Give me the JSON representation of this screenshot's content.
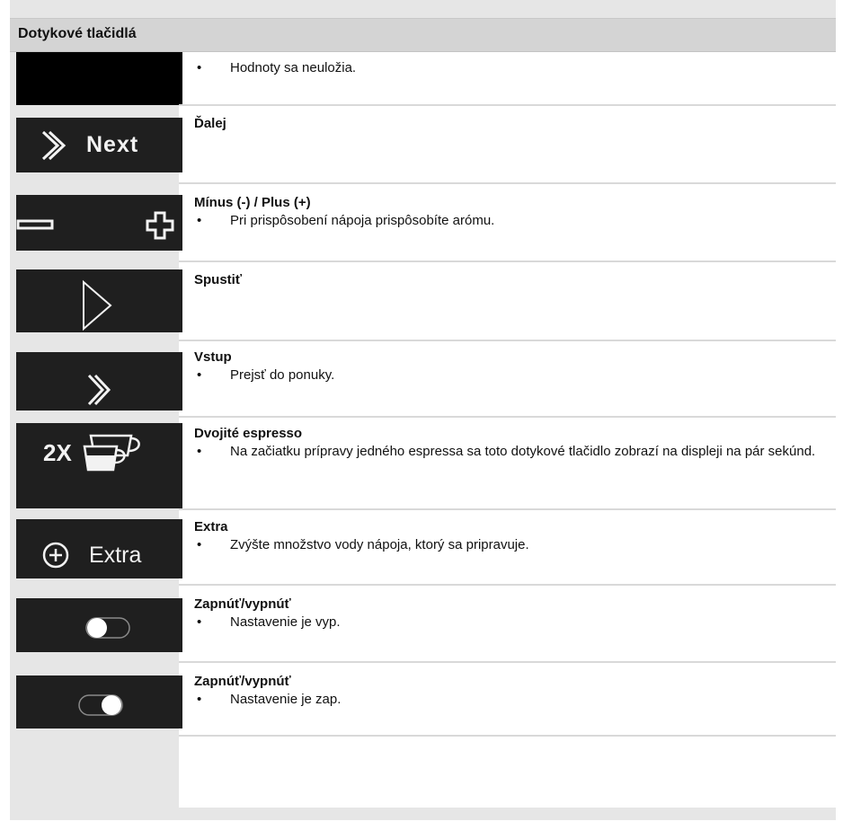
{
  "table": {
    "header": "Dotykové tlačidlá",
    "rows": [
      {
        "key": "no-save",
        "tile_label": "",
        "title": "",
        "bullets": [
          "Hodnoty sa neuložia."
        ]
      },
      {
        "key": "next",
        "tile_label": "Next",
        "title": "Ďalej",
        "bullets": []
      },
      {
        "key": "minus-plus",
        "tile_label": "",
        "title": "Mínus (-) / Plus (+)",
        "bullets": [
          "Pri prispôsobení nápoja prispôsobíte arómu."
        ]
      },
      {
        "key": "start",
        "tile_label": "",
        "title": "Spustiť",
        "bullets": []
      },
      {
        "key": "enter",
        "tile_label": "",
        "title": "Vstup",
        "bullets": [
          "Prejsť do ponuky."
        ]
      },
      {
        "key": "double-espresso",
        "tile_label": "2X",
        "title": "Dvojité espresso",
        "bullets": [
          "Na začiatku prípravy jedného espressa sa toto dotykové tlačidlo zobrazí na displeji na pár sekúnd."
        ]
      },
      {
        "key": "extra",
        "tile_label": "Extra",
        "title": "Extra",
        "bullets": [
          "Zvýšte množstvo vody nápoja, ktorý sa pripravuje."
        ]
      },
      {
        "key": "toggle-off",
        "tile_label": "",
        "title": "Zapnúť/vypnúť",
        "bullets": [
          "Nastavenie je vyp."
        ]
      },
      {
        "key": "toggle-on",
        "tile_label": "",
        "title": "Zapnúť/vypnúť",
        "bullets": [
          "Nastavenie je zap."
        ]
      }
    ]
  },
  "icons": {
    "next": "chevron-right-double-icon",
    "minus_plus": "minus-plus-icon",
    "start": "play-triangle-icon",
    "enter": "chevron-right-double-icon",
    "double_espresso": "two-cups-icon",
    "extra": "plus-circle-icon",
    "toggle_off": "toggle-off-icon",
    "toggle_on": "toggle-on-icon"
  },
  "colors": {
    "tile": "#1f1f1f",
    "tile_black": "#000000",
    "glyph": "#f2f2f2",
    "frame": "#e6e6e6",
    "header": "#d4d4d4"
  }
}
